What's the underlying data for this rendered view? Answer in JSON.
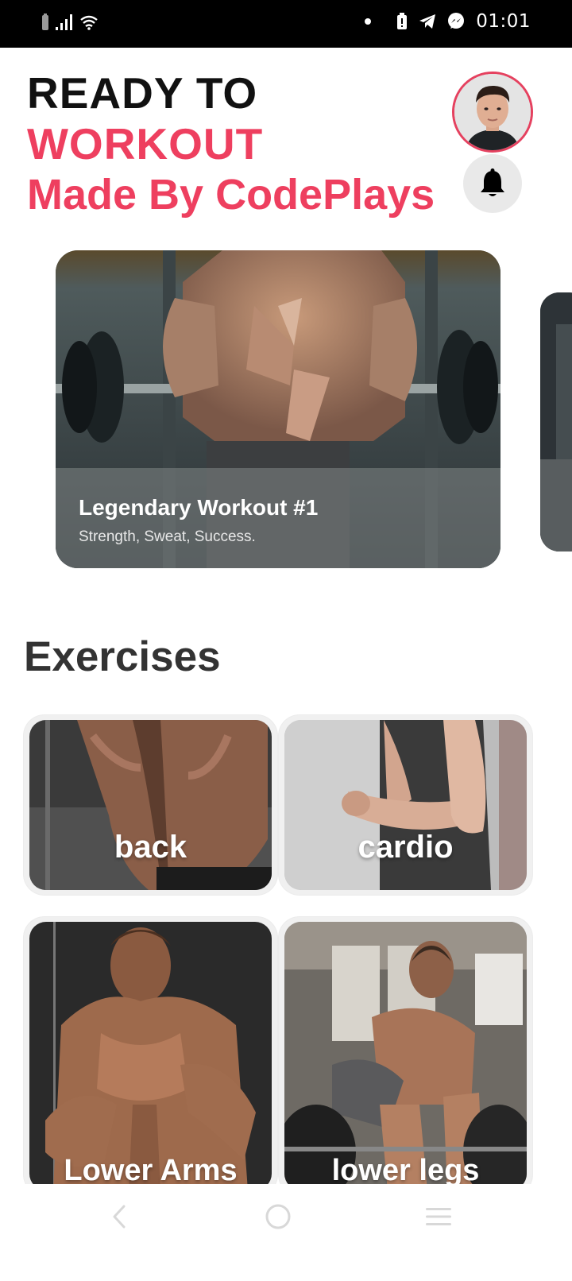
{
  "status_bar": {
    "time": "01:01",
    "icons": [
      "battery-icon",
      "signal-icon",
      "wifi-icon",
      "dot-icon",
      "battery-alert-icon",
      "telegram-icon",
      "messenger-icon"
    ]
  },
  "header": {
    "line1": "READY TO",
    "line2": "WORKOUT",
    "line3": "Made By CodePlays",
    "accent_color": "#ee3f5f"
  },
  "featured": {
    "title": "Legendary Workout #1",
    "subtitle": "Strength, Sweat, Success."
  },
  "exercises": {
    "section_title": "Exercises",
    "items": [
      {
        "label": "back"
      },
      {
        "label": "cardio"
      },
      {
        "label": "Lower Arms"
      },
      {
        "label": "lower legs"
      }
    ]
  },
  "nav": {
    "buttons": [
      "back-icon",
      "home-icon",
      "recents-icon"
    ]
  }
}
